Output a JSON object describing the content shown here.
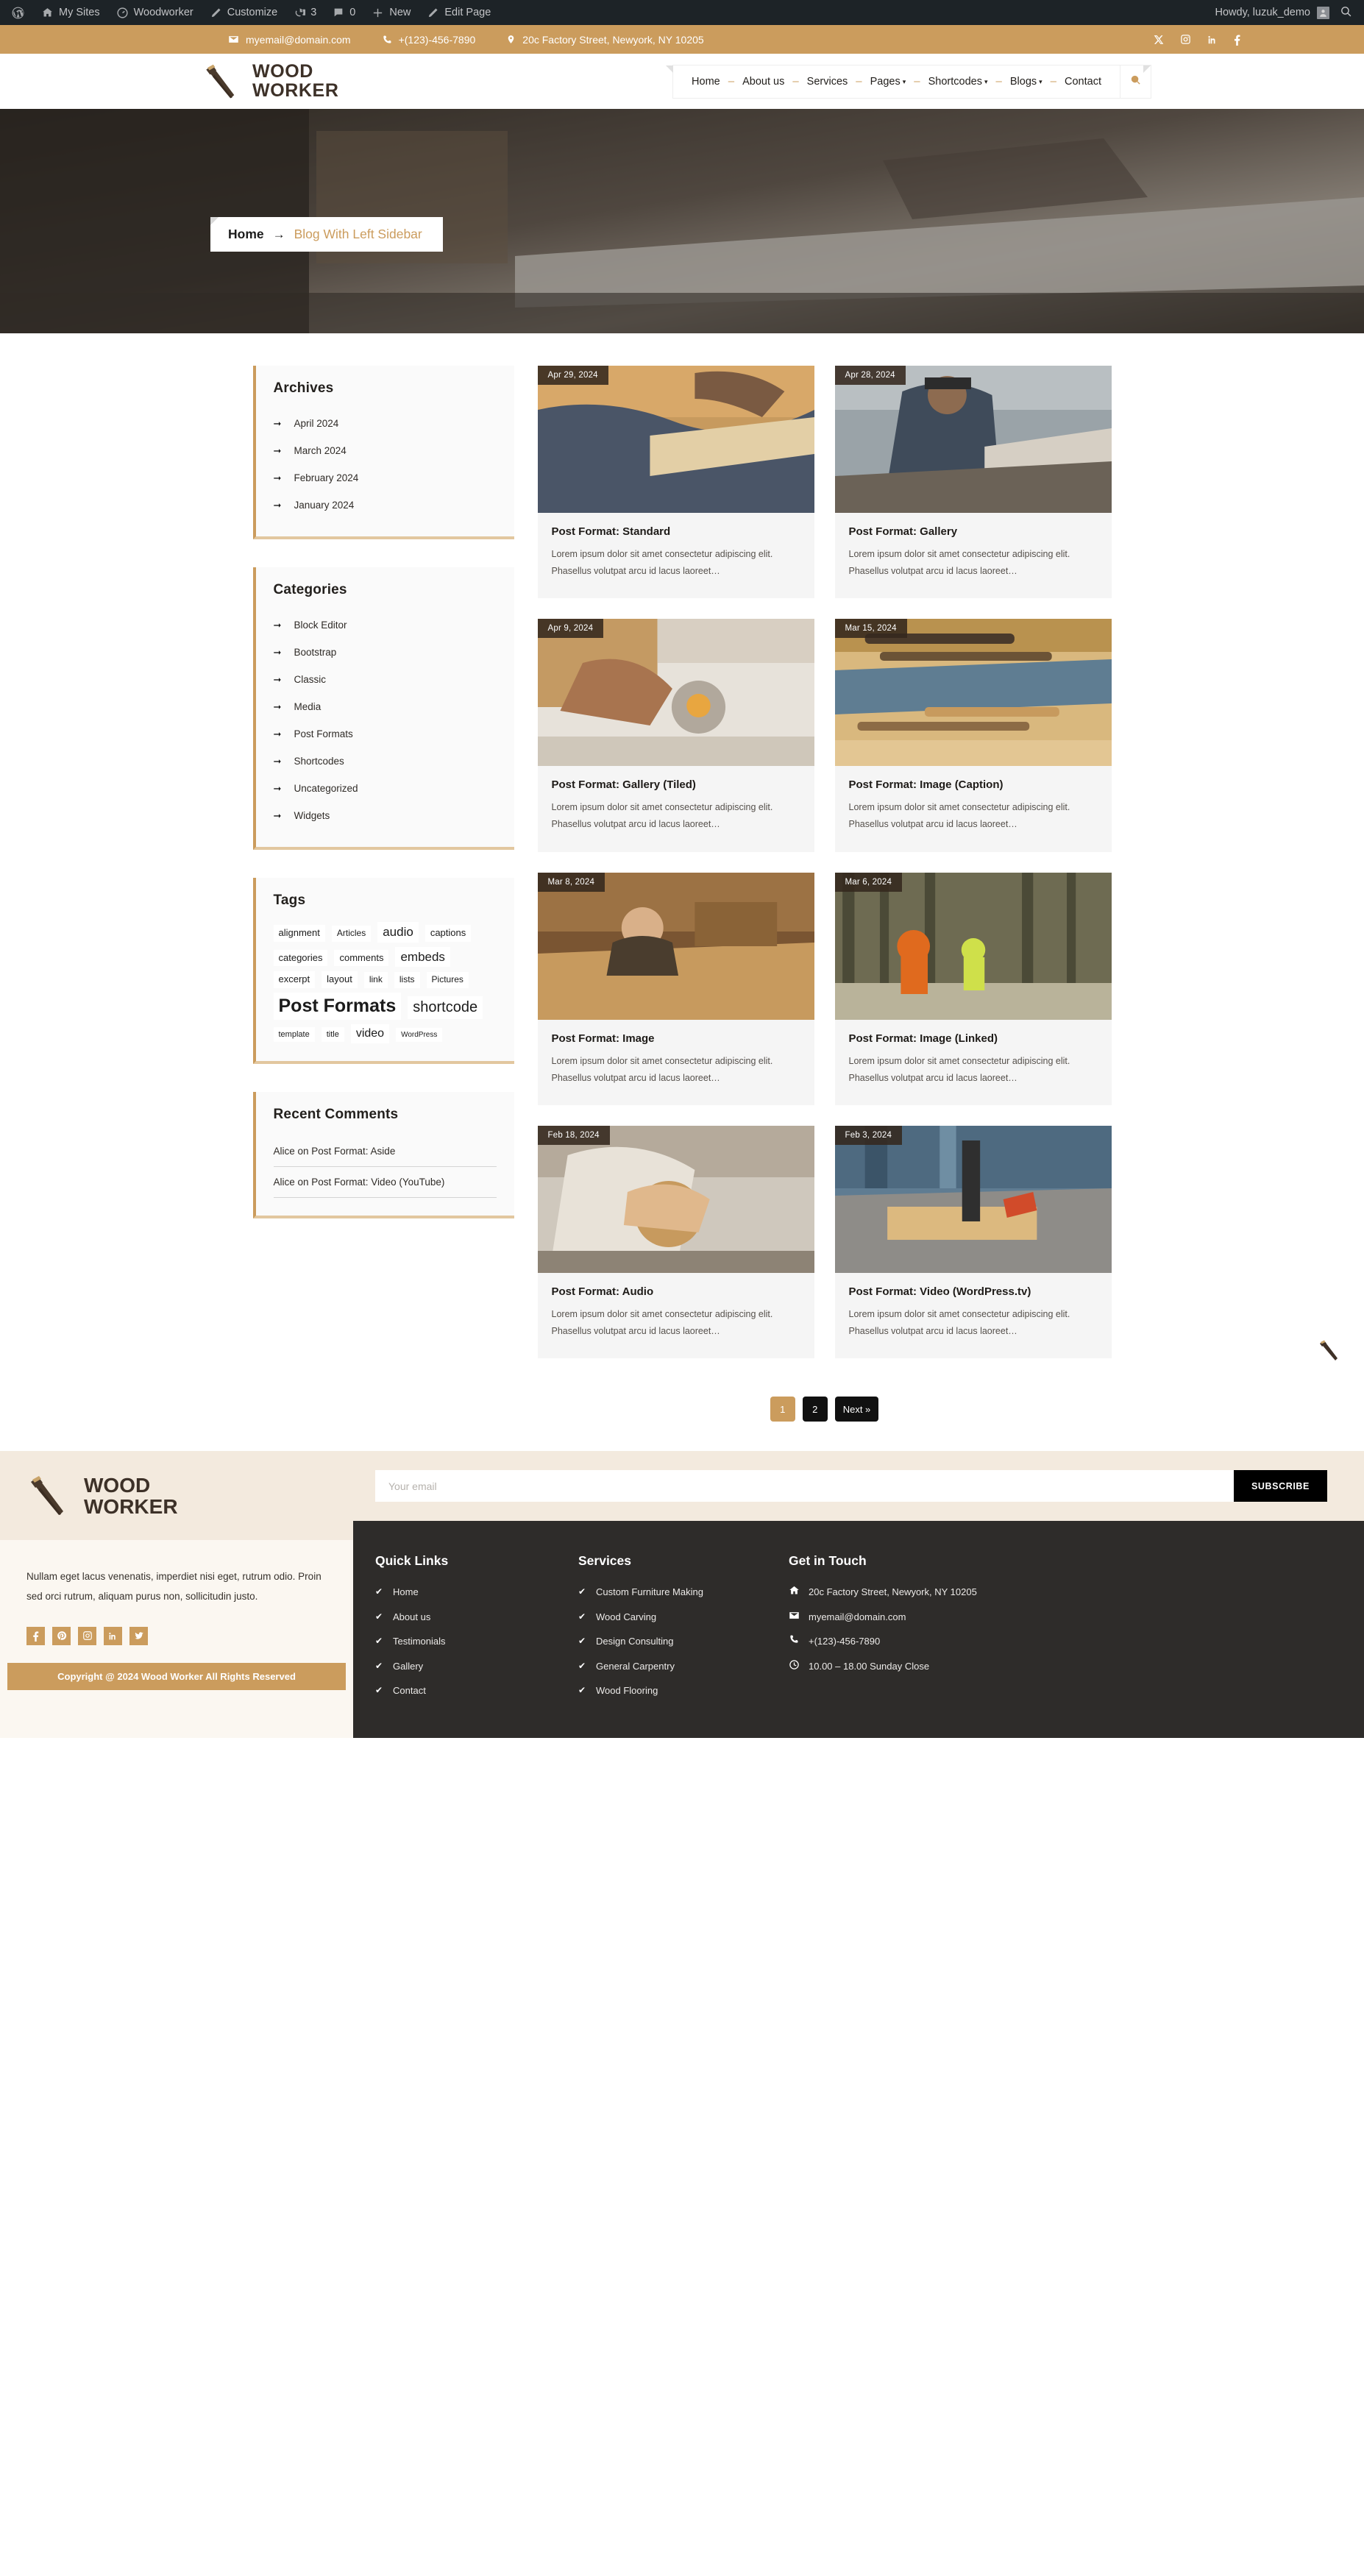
{
  "adminbar": {
    "items": [
      {
        "label": "My Sites",
        "icon": "sites-icon"
      },
      {
        "label": "Woodworker",
        "icon": "dashboard-icon"
      },
      {
        "label": "Customize",
        "icon": "pencil-icon"
      },
      {
        "label": "3",
        "icon": "updates-icon"
      },
      {
        "label": "0",
        "icon": "comment-icon"
      },
      {
        "label": "New",
        "icon": "plus-icon"
      },
      {
        "label": "Edit Page",
        "icon": "edit-icon"
      }
    ],
    "howdy": "Howdy, luzuk_demo",
    "search_icon": "search-icon",
    "wp_logo": "wordpress-logo-icon"
  },
  "topbar": {
    "email": "myemail@domain.com",
    "phone": "+(123)-456-7890",
    "address": "20c Factory Street, Newyork, NY 10205",
    "socials": [
      "x-icon",
      "instagram-icon",
      "linkedin-icon",
      "facebook-icon"
    ],
    "bg_color": "#cb9c5d"
  },
  "header": {
    "brand_line1": "WOOD",
    "brand_line2": "WORKER",
    "logo_icon": "handsaw-icon",
    "nav": [
      {
        "label": "Home",
        "has_caret": false
      },
      {
        "label": "About us",
        "has_caret": false
      },
      {
        "label": "Services",
        "has_caret": false
      },
      {
        "label": "Pages",
        "has_caret": true
      },
      {
        "label": "Shortcodes",
        "has_caret": true
      },
      {
        "label": "Blogs",
        "has_caret": true
      },
      {
        "label": "Contact",
        "has_caret": false
      }
    ],
    "search_icon": "search-icon"
  },
  "breadcrumb": {
    "home": "Home",
    "arrow": "→",
    "current": "Blog With Left Sidebar"
  },
  "sidebar": {
    "archives": {
      "title": "Archives",
      "items": [
        "April 2024",
        "March 2024",
        "February 2024",
        "January 2024"
      ]
    },
    "categories": {
      "title": "Categories",
      "items": [
        "Block Editor",
        "Bootstrap",
        "Classic",
        "Media",
        "Post Formats",
        "Shortcodes",
        "Uncategorized",
        "Widgets"
      ]
    },
    "tags": {
      "title": "Tags",
      "items": [
        {
          "label": "alignment",
          "size": 13
        },
        {
          "label": "Articles",
          "size": 12
        },
        {
          "label": "audio",
          "size": 17
        },
        {
          "label": "captions",
          "size": 13
        },
        {
          "label": "categories",
          "size": 13
        },
        {
          "label": "comments",
          "size": 13
        },
        {
          "label": "embeds",
          "size": 17
        },
        {
          "label": "excerpt",
          "size": 13
        },
        {
          "label": "layout",
          "size": 13
        },
        {
          "label": "link",
          "size": 12
        },
        {
          "label": "lists",
          "size": 12
        },
        {
          "label": "Pictures",
          "size": 12
        },
        {
          "label": "Post Formats",
          "size": 25
        },
        {
          "label": "shortcode",
          "size": 20
        },
        {
          "label": "template",
          "size": 11
        },
        {
          "label": "title",
          "size": 11
        },
        {
          "label": "video",
          "size": 16
        },
        {
          "label": "WordPress",
          "size": 10
        }
      ]
    },
    "recent_comments": {
      "title": "Recent Comments",
      "items": [
        "Alice on Post Format: Aside",
        "Alice on Post Format: Video (YouTube)"
      ]
    }
  },
  "posts": [
    {
      "date": "Apr 29, 2024",
      "title": "Post Format: Standard",
      "excerpt": "Lorem ipsum dolor sit amet consectetur adipiscing elit. Phasellus volutpat arcu id lacus laoreet…",
      "img": "workshop-handsaw"
    },
    {
      "date": "Apr 28, 2024",
      "title": "Post Format: Gallery",
      "excerpt": "Lorem ipsum dolor sit amet consectetur adipiscing elit. Phasellus volutpat arcu id lacus laoreet…",
      "img": "circular-saw-worker"
    },
    {
      "date": "Apr 9, 2024",
      "title": "Post Format: Gallery (Tiled)",
      "excerpt": "Lorem ipsum dolor sit amet consectetur adipiscing elit. Phasellus volutpat arcu id lacus laoreet…",
      "img": "sanding-block"
    },
    {
      "date": "Mar 15, 2024",
      "title": "Post Format: Image (Caption)",
      "excerpt": "Lorem ipsum dolor sit amet consectetur adipiscing elit. Phasellus volutpat arcu id lacus laoreet…",
      "img": "chisels-tools"
    },
    {
      "date": "Mar 8, 2024",
      "title": "Post Format: Image",
      "excerpt": "Lorem ipsum dolor sit amet consectetur adipiscing elit. Phasellus volutpat arcu id lacus laoreet…",
      "img": "craftsman-bench"
    },
    {
      "date": "Mar 6, 2024",
      "title": "Post Format: Image (Linked)",
      "excerpt": "Lorem ipsum dolor sit amet consectetur adipiscing elit. Phasellus volutpat arcu id lacus laoreet…",
      "img": "forest-chainsaw"
    },
    {
      "date": "Feb 18, 2024",
      "title": "Post Format: Audio",
      "excerpt": "Lorem ipsum dolor sit amet consectetur adipiscing elit. Phasellus volutpat arcu id lacus laoreet…",
      "img": "hands-carving"
    },
    {
      "date": "Feb 3, 2024",
      "title": "Post Format: Video (WordPress.tv)",
      "excerpt": "Lorem ipsum dolor sit amet consectetur adipiscing elit. Phasellus volutpat arcu id lacus laoreet…",
      "img": "drill-press"
    }
  ],
  "pagination": {
    "pages": [
      "1",
      "2"
    ],
    "next": "Next »",
    "current": "1"
  },
  "footer": {
    "brand_line1": "WOOD",
    "brand_line2": "WORKER",
    "logo_icon": "handsaw-icon",
    "about": "Nullam eget lacus venenatis, imperdiet nisi eget, rutrum odio. Proin sed orci rutrum, aliquam purus non, sollicitudin justo.",
    "socials": [
      "facebook-icon",
      "pinterest-icon",
      "instagram-icon",
      "linkedin-icon",
      "twitter-icon"
    ],
    "copyright": "Copyright @ 2024 Wood Worker All Rights Reserved",
    "subscribe": {
      "placeholder": "Your email",
      "button": "SUBSCRIBE",
      "value": ""
    },
    "quick_links": {
      "title": "Quick Links",
      "items": [
        "Home",
        "About us",
        "Testimonials",
        "Gallery",
        "Contact"
      ]
    },
    "services": {
      "title": "Services",
      "items": [
        "Custom Furniture Making",
        "Wood Carving",
        "Design Consulting",
        "General Carpentry",
        "Wood Flooring"
      ]
    },
    "get_in_touch": {
      "title": "Get in Touch",
      "items": [
        {
          "icon": "home-icon",
          "text": "20c Factory Street, Newyork, NY 10205"
        },
        {
          "icon": "mail-icon",
          "text": "myemail@domain.com"
        },
        {
          "icon": "phone-icon",
          "text": "+(123)-456-7890"
        },
        {
          "icon": "clock-icon",
          "text": "10.00 – 18.00 Sunday Close"
        }
      ]
    }
  }
}
